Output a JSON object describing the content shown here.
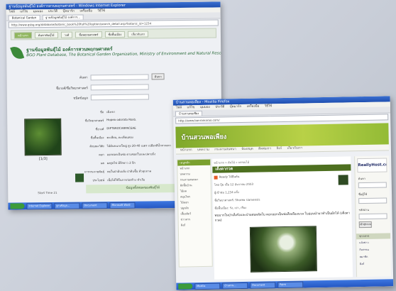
{
  "window1": {
    "titlebar": "ฐานข้อมูลพันธุ์ไม้ องค์การสวนพฤกษศาสตร์ - Windows Internet Explorer",
    "menu": [
      "ไฟล์",
      "แก้ไข",
      "มุมมอง",
      "ประวัติ",
      "บุ๊คมาร์ก",
      "เครื่องมือ",
      "วิธีใช้"
    ],
    "tabs": [
      "Botanical Garden",
      "ฐานข้อมูลพันธุ์ไม้ องค์การ..."
    ],
    "address": "http://www.qsbg.org/database/botanic_book%20full%20option/search_detail.asp?botanic_id=1234",
    "nav": [
      "หน้าแรก",
      "ค้นหาพันธุ์ไม้",
      "วงศ์",
      "ชื่อพฤกษศาสตร์",
      "ชื่อพื้นเมือง",
      "เกี่ยวกับเรา"
    ],
    "header_title": "ฐานข้อมูลพันธุ์ไม้ องค์การสวนพฤกษศาสตร์",
    "header_subtitle": "BGO Plant Database, The Botanical Garden Organization, Ministry of Environment and Natural Resources, Thailand",
    "form": {
      "rows": [
        {
          "label": "ค้นหา",
          "button": "ค้นหา"
        },
        {
          "label": "ชื่อวงศ์/ชื่อวิทยาศาสตร์"
        },
        {
          "label": "ชนิดข้อมูล"
        }
      ]
    },
    "details": [
      {
        "label": "ชื่อ",
        "value": "เต็งเขา"
      },
      {
        "label": "ชื่อวิทยาศาสตร์",
        "value": "Hopea odorata Roxb."
      },
      {
        "label": "ชื่อวงศ์",
        "value": "DIPTEROCARPACEAE"
      },
      {
        "label": "ชื่อพื้นเมือง",
        "value": "ตะเคียน, ตะเคียนทอง"
      },
      {
        "label": "ลักษณะวิสัย",
        "value": "ไม้ต้นขนาดใหญ่ สูง 20-40 เมตร เปลือกสีน้ำตาลเทา"
      },
      {
        "label": "ดอก",
        "value": "ออกดอกเป็นช่อ ตามซอกใบและปลายกิ่ง"
      },
      {
        "label": "ผล",
        "value": "ผลรูปไข่ มีปีกยาว 2 ปีก"
      },
      {
        "label": "การกระจายพันธุ์",
        "value": "พบในป่าดิบแล้ง ป่าดิบชื้น ทั่วทุกภาค"
      },
      {
        "label": "ประโยชน์",
        "value": "เนื้อไม้ใช้ในการก่อสร้าง ทำเรือ"
      },
      {
        "label": "ข้อมูลอื่นๆ",
        "value": ""
      }
    ],
    "image_index": "[1/3]",
    "bottom_box": "ข้อมูลทั้งหมดของพันธุ์ไม้",
    "foot": "Start Time 21",
    "taskbar": [
      "Internet Explorer",
      "ฐานข้อมูล...",
      "Document",
      "Microsoft Word"
    ]
  },
  "window2": {
    "titlebar": "บ้านสวนพอเพียง - Mozilla Firefox",
    "menu": [
      "ไฟล์",
      "แก้ไข",
      "มุมมอง",
      "ประวัติ",
      "บุ๊คมาร์ก",
      "เครื่องมือ",
      "วิธีใช้"
    ],
    "tabs": [
      "บ้านสวนพอเพียง"
    ],
    "address": "http://www.banrainarao.com/",
    "banner_title": "บ้านสวนพอเพียง",
    "site_menu": [
      "หน้าแรก",
      "บทความ",
      "กระดานสนทนา",
      "ห้องสมุด",
      "ติดต่อเรา",
      "ลิงก์",
      "เกี่ยวกับเรา"
    ],
    "left_sidebar": {
      "heading": "เมนูหลัก",
      "items": [
        "หน้าแรก",
        "บทความ",
        "กระดานสนทนา",
        "ผักพื้นบ้าน",
        "ไม้ผล",
        "สมุนไพร",
        "ไม้ดอก",
        "ปลูกผัก",
        "เลี้ยงสัตว์",
        "ข่าวสาร",
        "ลิงก์"
      ]
    },
    "main": {
      "crumb": "หน้าแรก » ต้นไม้ » พรรณไม้",
      "heading": "เต็งตากวด",
      "lines": [
        "Ready ไม้ยืนต้น",
        "โดย ปุ้ม เมื่อ 12 ธันวาคม 2553",
        "ผู้เข้าชม 1,234 ครั้ง",
        "ชื่อวิทยาศาสตร์: Shorea siamensis",
        "ชื่อพื้นเมือง: รัง, เปา, เรียง"
      ],
      "paragraph": "พบมากในป่าเต็งรังและป่าผสมผลัดใบ ดอกออกเป็นช่อสีเหลืองนวล ใบอ่อนนำมาทำเป็นผักได้ (เต็งตากวด)"
    },
    "right_sidebar": {
      "ad": "ReallyHost.com",
      "labels": [
        "ค้นหา",
        "ชื่อผู้ใช้",
        "รหัสผ่าน"
      ],
      "button": "เข้าสู่ระบบ",
      "section": "ข่าวสาร",
      "links": [
        "แจ้งข่าว",
        "กิจกรรม",
        "สมาชิก",
        "ลิงก์"
      ]
    },
    "taskbar": [
      "Mozilla",
      "บ้านสวน...",
      "Document",
      "Paint"
    ]
  }
}
